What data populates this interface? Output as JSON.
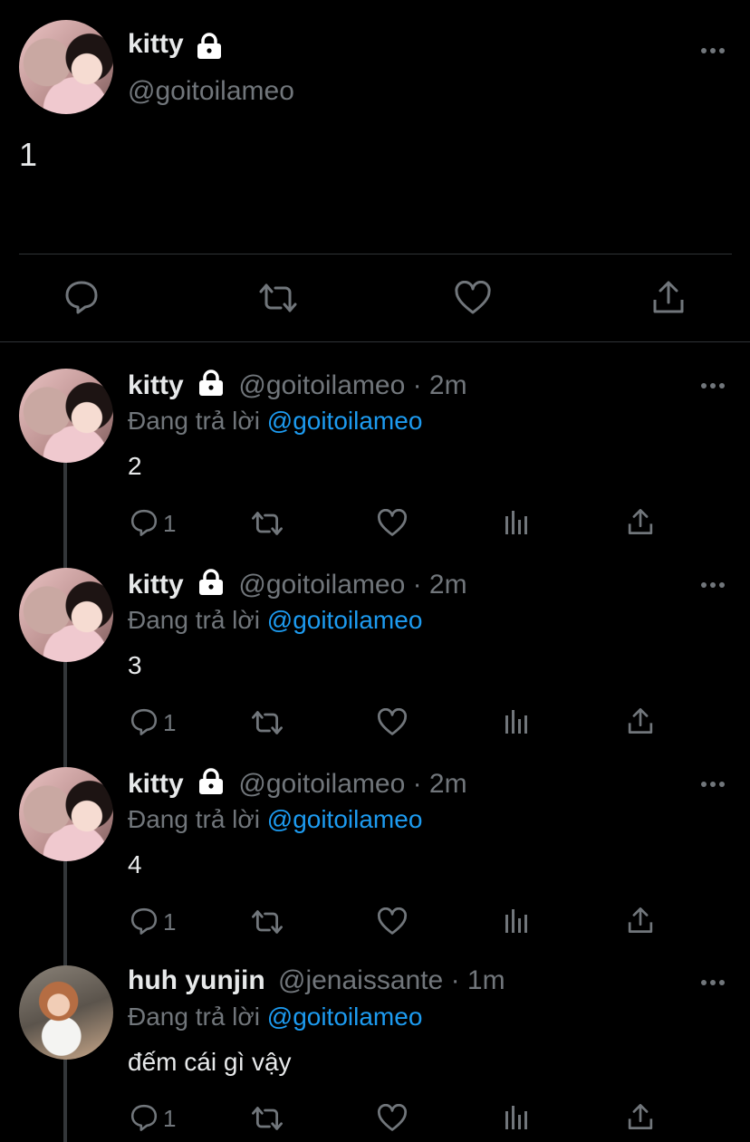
{
  "main_tweet": {
    "name": "kitty",
    "handle": "@goitoilameo",
    "text": "1"
  },
  "replies": [
    {
      "name": "kitty",
      "handle": "@goitoilameo",
      "time": "· 2m",
      "reply_prefix": "Đang trả lời",
      "reply_to": "@goitoilameo",
      "text": "2",
      "reply_count": "1"
    },
    {
      "name": "kitty",
      "handle": "@goitoilameo",
      "time": "· 2m",
      "reply_prefix": "Đang trả lời",
      "reply_to": "@goitoilameo",
      "text": "3",
      "reply_count": "1"
    },
    {
      "name": "kitty",
      "handle": "@goitoilameo",
      "time": "· 2m",
      "reply_prefix": "Đang trả lời",
      "reply_to": "@goitoilameo",
      "text": "4",
      "reply_count": "1"
    },
    {
      "name": "huh yunjin",
      "handle": "@jenaissante",
      "time": "· 1m",
      "reply_prefix": "Đang trả lời",
      "reply_to": "@goitoilameo",
      "text": "đếm cái gì vậy",
      "reply_count": "1"
    }
  ],
  "icons": {
    "lock": "lock-icon",
    "more": "more-icon",
    "reply": "reply-icon",
    "retweet": "retweet-icon",
    "like": "like-icon",
    "share": "share-icon",
    "analytics": "analytics-icon"
  },
  "colors": {
    "background": "#000000",
    "text": "#e7e9ea",
    "muted": "#71767b",
    "link": "#1d9bf0",
    "divider": "#2f3336"
  }
}
